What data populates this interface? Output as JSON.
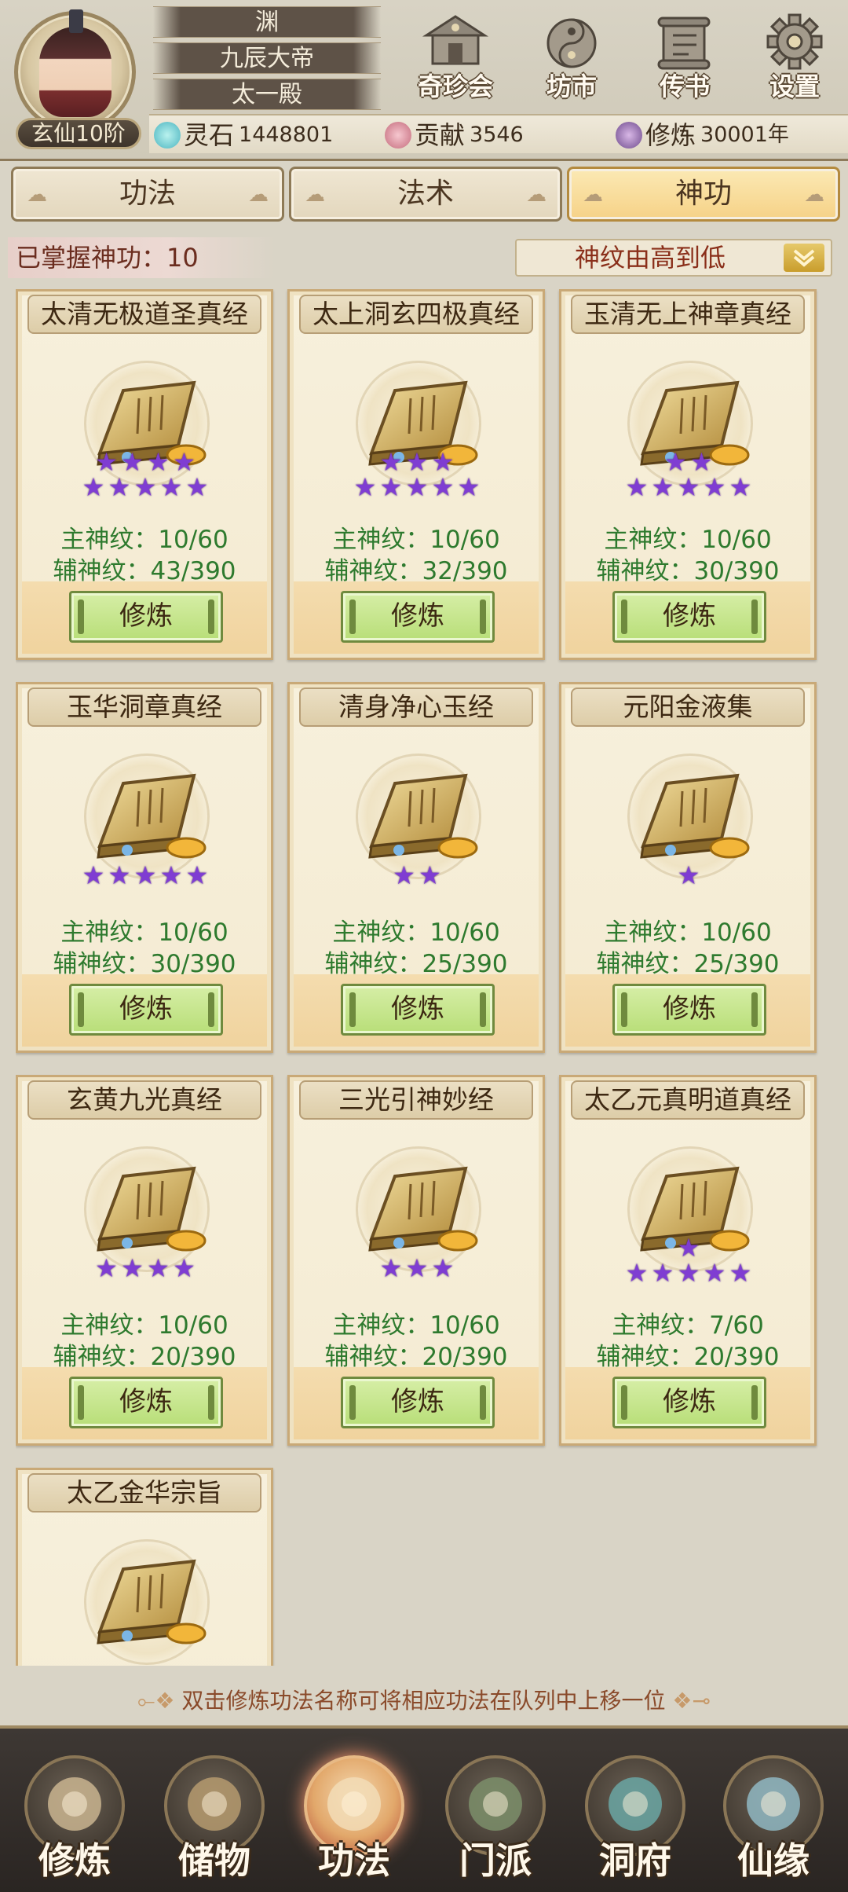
{
  "player": {
    "rank": "玄仙10阶",
    "title_1": "渊",
    "title_2": "九辰大帝",
    "title_3": "太一殿"
  },
  "top_nav": [
    {
      "label": "奇珍会",
      "icon": "treasure-pavilion-icon"
    },
    {
      "label": "坊市",
      "icon": "market-icon"
    },
    {
      "label": "传书",
      "icon": "scroll-mail-icon"
    },
    {
      "label": "设置",
      "icon": "gear-icon"
    }
  ],
  "resources": {
    "spirit_stone_label": "灵石",
    "spirit_stone_value": "1448801",
    "contribution_label": "贡献",
    "contribution_value": "3546",
    "cultivation_label": "修炼",
    "cultivation_value": "30001年"
  },
  "tabs": [
    {
      "label": "功法",
      "active": false
    },
    {
      "label": "法术",
      "active": false
    },
    {
      "label": "神功",
      "active": true
    }
  ],
  "mastered_text": "已掌握神功：10",
  "sort_label": "神纹由高到低",
  "train_label": "修炼",
  "cards": [
    {
      "title": "太清无极道圣真经",
      "stars": 9,
      "main": "主神纹：10/60",
      "aux": "辅神纹：43/390"
    },
    {
      "title": "太上洞玄四极真经",
      "stars": 8,
      "main": "主神纹：10/60",
      "aux": "辅神纹：32/390"
    },
    {
      "title": "玉清无上神章真经",
      "stars": 7,
      "main": "主神纹：10/60",
      "aux": "辅神纹：30/390"
    },
    {
      "title": "玉华洞章真经",
      "stars": 5,
      "main": "主神纹：10/60",
      "aux": "辅神纹：30/390"
    },
    {
      "title": "清身净心玉经",
      "stars": 2,
      "main": "主神纹：10/60",
      "aux": "辅神纹：25/390"
    },
    {
      "title": "元阳金液集",
      "stars": 1,
      "main": "主神纹：10/60",
      "aux": "辅神纹：25/390"
    },
    {
      "title": "玄黄九光真经",
      "stars": 4,
      "main": "主神纹：10/60",
      "aux": "辅神纹：20/390"
    },
    {
      "title": "三光引神妙经",
      "stars": 3,
      "main": "主神纹：10/60",
      "aux": "辅神纹：20/390"
    },
    {
      "title": "太乙元真明道真经",
      "stars": 6,
      "main": "主神纹：7/60",
      "aux": "辅神纹：20/390"
    },
    {
      "title": "太乙金华宗旨",
      "stars": 0,
      "main": "",
      "aux": ""
    }
  ],
  "tip": "双击修炼功法名称可将相应功法在队列中上移一位",
  "bottom_nav": [
    {
      "label": "修炼",
      "icon": "cultivation-icon",
      "active": false
    },
    {
      "label": "储物",
      "icon": "storage-bag-icon",
      "active": false
    },
    {
      "label": "功法",
      "icon": "technique-scroll-icon",
      "active": true
    },
    {
      "label": "门派",
      "icon": "sect-gate-icon",
      "active": false
    },
    {
      "label": "洞府",
      "icon": "cave-dwelling-icon",
      "active": false
    },
    {
      "label": "仙缘",
      "icon": "immortal-fate-icon",
      "active": false
    }
  ],
  "colors": {
    "star": "#7f3dd2",
    "stat_text": "#2e7a2e",
    "sort_text": "#8a2f1a",
    "active_tab": "#f6d287"
  }
}
